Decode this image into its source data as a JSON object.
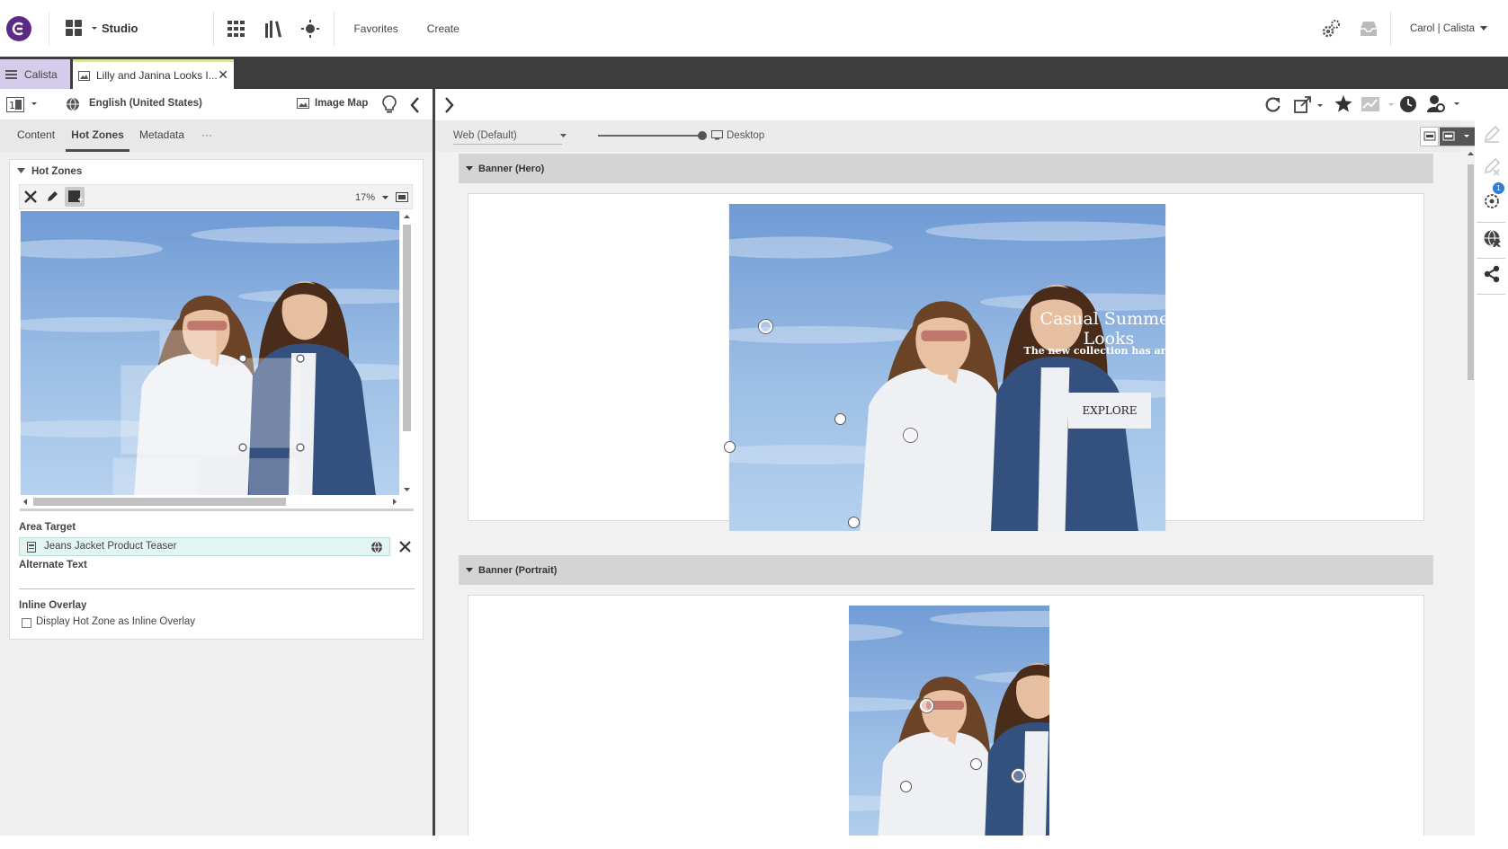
{
  "topbar": {
    "app_name": "Studio",
    "favorites": "Favorites",
    "create": "Create",
    "user": "Carol | Calista"
  },
  "tabs": [
    {
      "label": "Calista"
    },
    {
      "label": "Lilly and Janina Looks I..."
    }
  ],
  "left_toolbar": {
    "locale": "English (United States)",
    "image_map": "Image Map"
  },
  "left_tabs": [
    {
      "label": "Content"
    },
    {
      "label": "Hot Zones"
    },
    {
      "label": "Metadata"
    },
    {
      "label": "···"
    }
  ],
  "hot_zones": {
    "title": "Hot Zones",
    "zoom": "17%",
    "area_target_label": "Area Target",
    "area_target_value": "Jeans Jacket Product Teaser",
    "alternate_text_label": "Alternate Text",
    "alternate_text_value": "",
    "inline_overlay_label": "Inline Overlay",
    "inline_overlay_checkbox": "Display Hot Zone as Inline Overlay"
  },
  "preview": {
    "channel": "Web (Default)",
    "device": "Desktop"
  },
  "banners": [
    {
      "section": "Banner (Hero)",
      "headline": "Casual Summer Looks",
      "subline": "The new collection has arrived",
      "cta": "EXPLORE"
    },
    {
      "section": "Banner (Portrait)"
    }
  ],
  "sidebar": {
    "notification_count": "1"
  },
  "colors": {
    "brand": "#5b2a86",
    "tab_active_bg": "#d4ccea",
    "tab_accent": "#d8e69a",
    "sky_top": "#7ea7d8",
    "sky_bottom": "#a8c8ea",
    "denim": "#34507e"
  }
}
